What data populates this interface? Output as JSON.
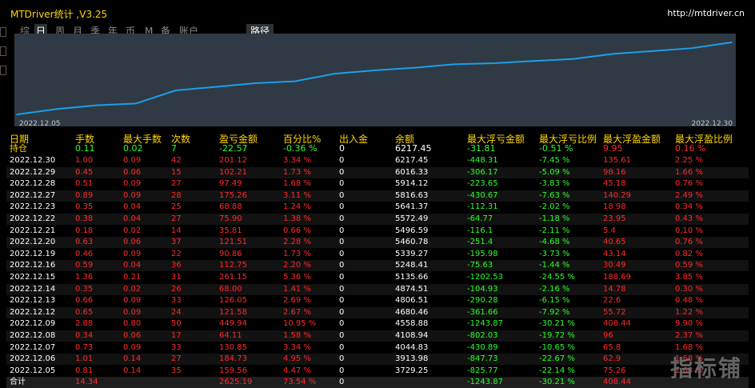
{
  "window": {
    "title": "MTDriver统计 ,V3.25",
    "url": "http://mtdriver.cn"
  },
  "tabs": [
    "综",
    "日",
    "周",
    "月",
    "季",
    "年",
    "币",
    "M",
    "备",
    "账户"
  ],
  "active_tab": "日",
  "path_button": "路径",
  "chart_data": {
    "type": "line",
    "x_start": "2022.12.05",
    "x_end": "2022.12.30",
    "x": [
      "2022.12.05",
      "2022.12.06",
      "2022.12.07",
      "2022.12.08",
      "2022.12.09",
      "2022.12.12",
      "2022.12.13",
      "2022.12.14",
      "2022.12.15",
      "2022.12.16",
      "2022.12.19",
      "2022.12.20",
      "2022.12.21",
      "2022.12.22",
      "2022.12.23",
      "2022.12.27",
      "2022.12.28",
      "2022.12.29",
      "2022.12.30"
    ],
    "values": [
      3729.25,
      3913.98,
      4044.83,
      4108.94,
      4558.88,
      4680.46,
      4806.51,
      4874.51,
      5135.66,
      5248.41,
      5339.27,
      5460.78,
      5496.59,
      5572.49,
      5641.37,
      5816.63,
      5914.12,
      6016.33,
      6217.45
    ],
    "line_color": "#1e9ee6",
    "background": "#2f3a45"
  },
  "headers": [
    "日期",
    "手数",
    "最大手数",
    "次数",
    "盈亏金额",
    "百分比%",
    "出入金",
    "余额",
    "最大浮亏金额",
    "最大浮亏比例",
    "最大浮盈金额",
    "最大浮盈比例"
  ],
  "holding": {
    "label": "持仓",
    "lots": "0.11",
    "max_lots": "0.02",
    "count": "7",
    "pnl": "-22.57",
    "pct": "-0.36 %",
    "inout": "0",
    "balance": "6217.45",
    "max_float_loss": "-31.81",
    "max_float_loss_pct": "-0.51 %",
    "max_float_profit": "9.95",
    "max_float_profit_pct": "0.16 %"
  },
  "rows": [
    {
      "date": "2022.12.30",
      "lots": "1.00",
      "max_lots": "0.09",
      "count": "42",
      "pnl": "201.12",
      "pct": "3.34 %",
      "inout": "0",
      "balance": "6217.45",
      "mfl": "-448.31",
      "mflp": "-7.45 %",
      "mfp": "135.61",
      "mfpp": "2.25 %"
    },
    {
      "date": "2022.12.29",
      "lots": "0.45",
      "max_lots": "0.06",
      "count": "15",
      "pnl": "102.21",
      "pct": "1.73 %",
      "inout": "0",
      "balance": "6016.33",
      "mfl": "-306.17",
      "mflp": "-5.09 %",
      "mfp": "98.16",
      "mfpp": "1.66 %"
    },
    {
      "date": "2022.12.28",
      "lots": "0.51",
      "max_lots": "0.09",
      "count": "27",
      "pnl": "97.49",
      "pct": "1.68 %",
      "inout": "0",
      "balance": "5914.12",
      "mfl": "-223.65",
      "mflp": "-3.83 %",
      "mfp": "45.18",
      "mfpp": "0.76 %"
    },
    {
      "date": "2022.12.27",
      "lots": "0.89",
      "max_lots": "0.09",
      "count": "28",
      "pnl": "175.26",
      "pct": "3.11 %",
      "inout": "0",
      "balance": "5816.63",
      "mfl": "-430.67",
      "mflp": "-7.63 %",
      "mfp": "140.29",
      "mfpp": "2.49 %"
    },
    {
      "date": "2022.12.23",
      "lots": "0.35",
      "max_lots": "0.04",
      "count": "25",
      "pnl": "68.88",
      "pct": "1.24 %",
      "inout": "0",
      "balance": "5641.37",
      "mfl": "-112.31",
      "mflp": "-2.02 %",
      "mfp": "18.98",
      "mfpp": "0.34 %"
    },
    {
      "date": "2022.12.22",
      "lots": "0.38",
      "max_lots": "0.04",
      "count": "27",
      "pnl": "75.90",
      "pct": "1.38 %",
      "inout": "0",
      "balance": "5572.49",
      "mfl": "-64.77",
      "mflp": "-1.18 %",
      "mfp": "23.95",
      "mfpp": "0.43 %"
    },
    {
      "date": "2022.12.21",
      "lots": "0.18",
      "max_lots": "0.02",
      "count": "14",
      "pnl": "35.81",
      "pct": "0.66 %",
      "inout": "0",
      "balance": "5496.59",
      "mfl": "-116.1",
      "mflp": "-2.11 %",
      "mfp": "5.4",
      "mfpp": "0.10 %"
    },
    {
      "date": "2022.12.20",
      "lots": "0.63",
      "max_lots": "0.06",
      "count": "37",
      "pnl": "121.51",
      "pct": "2.28 %",
      "inout": "0",
      "balance": "5460.78",
      "mfl": "-251.4",
      "mflp": "-4.68 %",
      "mfp": "40.65",
      "mfpp": "0.76 %"
    },
    {
      "date": "2022.12.19",
      "lots": "0.46",
      "max_lots": "0.09",
      "count": "22",
      "pnl": "90.86",
      "pct": "1.73 %",
      "inout": "0",
      "balance": "5339.27",
      "mfl": "-195.98",
      "mflp": "-3.73 %",
      "mfp": "43.14",
      "mfpp": "0.82 %"
    },
    {
      "date": "2022.12.16",
      "lots": "0.59",
      "max_lots": "0.04",
      "count": "36",
      "pnl": "112.75",
      "pct": "2.20 %",
      "inout": "0",
      "balance": "5248.41",
      "mfl": "-75.63",
      "mflp": "-1.44 %",
      "mfp": "30.49",
      "mfpp": "0.59 %"
    },
    {
      "date": "2022.12.15",
      "lots": "1.36",
      "max_lots": "0.21",
      "count": "31",
      "pnl": "261.15",
      "pct": "5.36 %",
      "inout": "0",
      "balance": "5135.66",
      "mfl": "-1202.53",
      "mflp": "-24.55 %",
      "mfp": "188.69",
      "mfpp": "3.85 %"
    },
    {
      "date": "2022.12.14",
      "lots": "0.35",
      "max_lots": "0.02",
      "count": "26",
      "pnl": "68.00",
      "pct": "1.41 %",
      "inout": "0",
      "balance": "4874.51",
      "mfl": "-104.93",
      "mflp": "-2.16 %",
      "mfp": "14.78",
      "mfpp": "0.30 %"
    },
    {
      "date": "2022.12.13",
      "lots": "0.66",
      "max_lots": "0.09",
      "count": "33",
      "pnl": "126.05",
      "pct": "2.69 %",
      "inout": "0",
      "balance": "4806.51",
      "mfl": "-290.28",
      "mflp": "-6.15 %",
      "mfp": "22.6",
      "mfpp": "0.48 %"
    },
    {
      "date": "2022.12.12",
      "lots": "0.65",
      "max_lots": "0.09",
      "count": "24",
      "pnl": "121.58",
      "pct": "2.67 %",
      "inout": "0",
      "balance": "4680.46",
      "mfl": "-361.66",
      "mflp": "-7.92 %",
      "mfp": "55.72",
      "mfpp": "1.22 %"
    },
    {
      "date": "2022.12.09",
      "lots": "2.88",
      "max_lots": "0.80",
      "count": "50",
      "pnl": "449.94",
      "pct": "10.95 %",
      "inout": "0",
      "balance": "4558.88",
      "mfl": "-1243.87",
      "mflp": "-30.21 %",
      "mfp": "408.44",
      "mfpp": "9.90 %"
    },
    {
      "date": "2022.12.08",
      "lots": "0.34",
      "max_lots": "0.06",
      "count": "17",
      "pnl": "64.11",
      "pct": "1.58 %",
      "inout": "0",
      "balance": "4108.94",
      "mfl": "-802.03",
      "mflp": "-19.72 %",
      "mfp": "96",
      "mfpp": "2.37 %"
    },
    {
      "date": "2022.12.07",
      "lots": "0.73",
      "max_lots": "0.09",
      "count": "33",
      "pnl": "130.85",
      "pct": "3.34 %",
      "inout": "0",
      "balance": "4044.83",
      "mfl": "-430.89",
      "mflp": "-10.65 %",
      "mfp": "65.8",
      "mfpp": "1.68 %"
    },
    {
      "date": "2022.12.06",
      "lots": "1.01",
      "max_lots": "0.14",
      "count": "27",
      "pnl": "184.73",
      "pct": "4.95 %",
      "inout": "0",
      "balance": "3913.98",
      "mfl": "-847.73",
      "mflp": "-22.67 %",
      "mfp": "62.9",
      "mfpp": "1.68 %"
    },
    {
      "date": "2022.12.05",
      "lots": "0.81",
      "max_lots": "0.14",
      "count": "35",
      "pnl": "159.56",
      "pct": "4.47 %",
      "inout": "0",
      "balance": "3729.25",
      "mfl": "-825.77",
      "mflp": "-22.14 %",
      "mfp": "75.26",
      "mfpp": "1.68 %"
    }
  ],
  "total": {
    "label": "合计",
    "lots": "14.34",
    "pnl": "2625.19",
    "pct": "73.54 %",
    "inout": "0",
    "mfl": "-1243.87",
    "mflp": "-30.21 %",
    "mfp": "408.44"
  },
  "watermark": "指标铺"
}
